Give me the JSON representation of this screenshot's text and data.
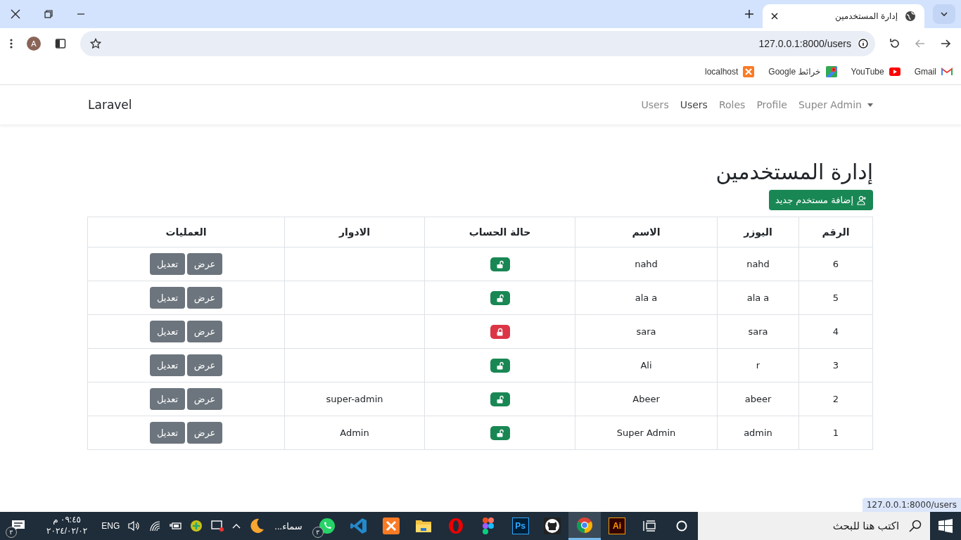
{
  "browser": {
    "tab_title": "إدارة المستخدمين",
    "url": "127.0.0.1:8000/users",
    "bookmarks": [
      {
        "label": "Gmail",
        "kind": "gmail"
      },
      {
        "label": "YouTube",
        "kind": "youtube"
      },
      {
        "label": "خرائط Google",
        "kind": "maps"
      },
      {
        "label": "localhost",
        "kind": "xampp"
      }
    ],
    "avatar": "A",
    "status_url": "127.0.0.1:8000/users"
  },
  "navbar": {
    "brand": "Laravel",
    "links": [
      {
        "label": "Super Admin",
        "selected": false,
        "dropdown": true
      },
      {
        "label": "Profile",
        "selected": false
      },
      {
        "label": "Roles",
        "selected": false
      },
      {
        "label": "Users",
        "selected": true
      },
      {
        "label": "Users",
        "selected": false
      }
    ]
  },
  "page": {
    "title": "إدارة المستخدمين",
    "add_button": "إضافة مستخدم جديد"
  },
  "table": {
    "columns": [
      "الرقم",
      "اليوزر",
      "الاسم",
      "حالة الحساب",
      "الادوار",
      "العمليات"
    ],
    "rows": [
      {
        "id": "6",
        "username": "nahd",
        "name": "nahd",
        "active": true,
        "roles": "",
        "actions": [
          "عرض",
          "تعديل"
        ]
      },
      {
        "id": "5",
        "username": "ala a",
        "name": "ala a",
        "active": true,
        "roles": "",
        "actions": [
          "عرض",
          "تعديل"
        ]
      },
      {
        "id": "4",
        "username": "sara",
        "name": "sara",
        "active": false,
        "roles": "",
        "actions": [
          "عرض",
          "تعديل"
        ]
      },
      {
        "id": "3",
        "username": "r",
        "name": "Ali",
        "active": true,
        "roles": "",
        "actions": [
          "عرض",
          "تعديل"
        ]
      },
      {
        "id": "2",
        "username": "abeer",
        "name": "Abeer",
        "active": true,
        "roles": "super-admin",
        "actions": [
          "عرض",
          "تعديل"
        ]
      },
      {
        "id": "1",
        "username": "admin",
        "name": "Super Admin",
        "active": true,
        "roles": "Admin",
        "actions": [
          "عرض",
          "تعديل"
        ]
      }
    ]
  },
  "taskbar": {
    "search_placeholder": "اكتب هنا للبحث",
    "apps": [
      {
        "kind": "illustrator",
        "label": "Ai",
        "selected": false
      },
      {
        "kind": "chrome",
        "selected": true
      },
      {
        "kind": "github",
        "selected": false
      },
      {
        "kind": "photoshop",
        "label": "Ps",
        "selected": false
      },
      {
        "kind": "figma",
        "selected": false
      },
      {
        "kind": "opera",
        "selected": false
      },
      {
        "kind": "files",
        "selected": false
      },
      {
        "kind": "xampp",
        "selected": false
      },
      {
        "kind": "vscode",
        "selected": false
      },
      {
        "kind": "whatsapp",
        "selected": false,
        "badge": "٣"
      }
    ],
    "weather": "سماء...",
    "language": "ENG",
    "time": "٠٩:٤٥ م",
    "date": "٢٠٢٤/٠٢/٠٢",
    "notification_badge": "٣"
  }
}
